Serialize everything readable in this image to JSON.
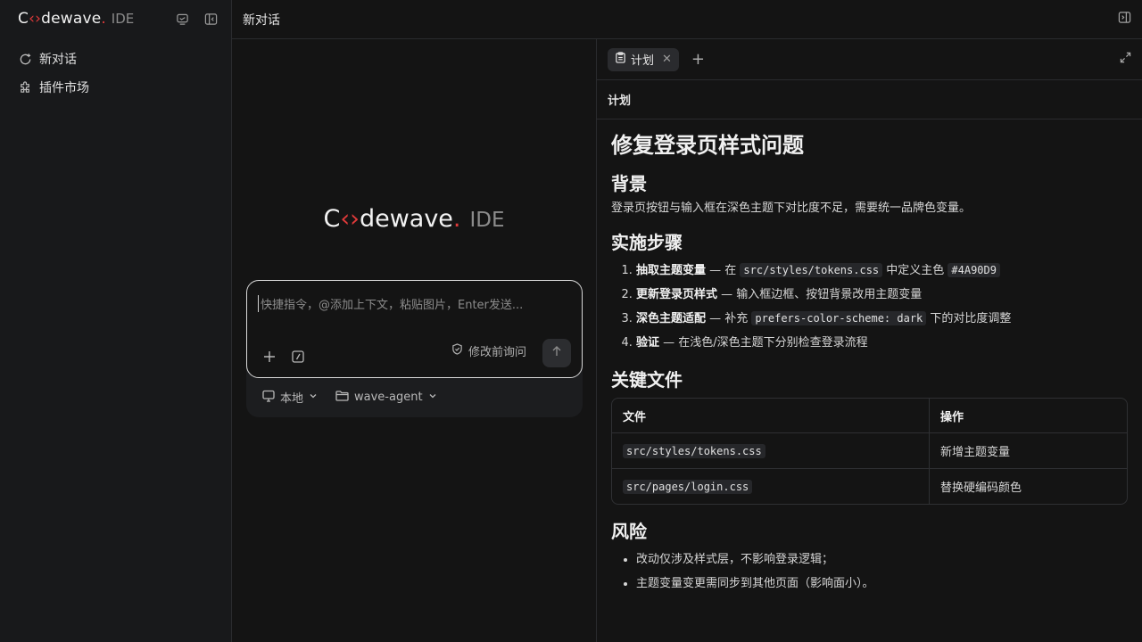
{
  "sidebar": {
    "logo": {
      "brand_pre": "C",
      "brand_post": "dewave",
      "dot": ".",
      "suffix": "IDE"
    },
    "items": [
      {
        "label": "新对话",
        "icon": "chat-plus-icon"
      },
      {
        "label": "插件市场",
        "icon": "puzzle-icon"
      }
    ]
  },
  "header": {
    "title": "新对话"
  },
  "chat": {
    "logo": {
      "brand_pre": "C",
      "brand_post": "dewave",
      "dot": ".",
      "suffix": "IDE"
    },
    "input_placeholder": "快捷指令，@添加上下文，粘贴图片，Enter发送...",
    "mode_label": "修改前询问",
    "footer": {
      "env_label": "本地",
      "folder_label": "wave-agent"
    }
  },
  "plan": {
    "tab_label": "计划",
    "panel_title": "计划",
    "doc": {
      "title": "修复登录页样式问题",
      "background_heading": "背景",
      "background_text": "登录页按钮与输入框在深色主题下对比度不足，需要统一品牌色变量。",
      "steps_heading": "实施步骤",
      "steps": [
        {
          "bold": "抽取主题变量",
          "t1": " — 在 ",
          "code1": "src/styles/tokens.css",
          "t2": " 中定义主色 ",
          "code2": "#4A90D9",
          "t3": ""
        },
        {
          "bold": "更新登录页样式",
          "t1": " — 输入框边框、按钮背景改用主题变量",
          "code1": "",
          "t2": "",
          "code2": "",
          "t3": ""
        },
        {
          "bold": "深色主题适配",
          "t1": " — 补充 ",
          "code1": "prefers-color-scheme: dark",
          "t2": " 下的对比度调整",
          "code2": "",
          "t3": ""
        },
        {
          "bold": "验证",
          "t1": " — 在浅色/深色主题下分别检查登录流程",
          "code1": "",
          "t2": "",
          "code2": "",
          "t3": ""
        }
      ],
      "files_heading": "关键文件",
      "files_table": {
        "headers": [
          "文件",
          "操作"
        ],
        "rows": [
          [
            "src/styles/tokens.css",
            "新增主题变量"
          ],
          [
            "src/pages/login.css",
            "替换硬编码颜色"
          ]
        ]
      },
      "risks_heading": "风险",
      "risks": [
        "改动仅涉及样式层，不影响登录逻辑；",
        "主题变量变更需同步到其他页面（影响面小）。"
      ]
    }
  },
  "colors": {
    "accent": "#e03a3a",
    "bg": "#141414",
    "sidebar_bg": "#18191b"
  }
}
